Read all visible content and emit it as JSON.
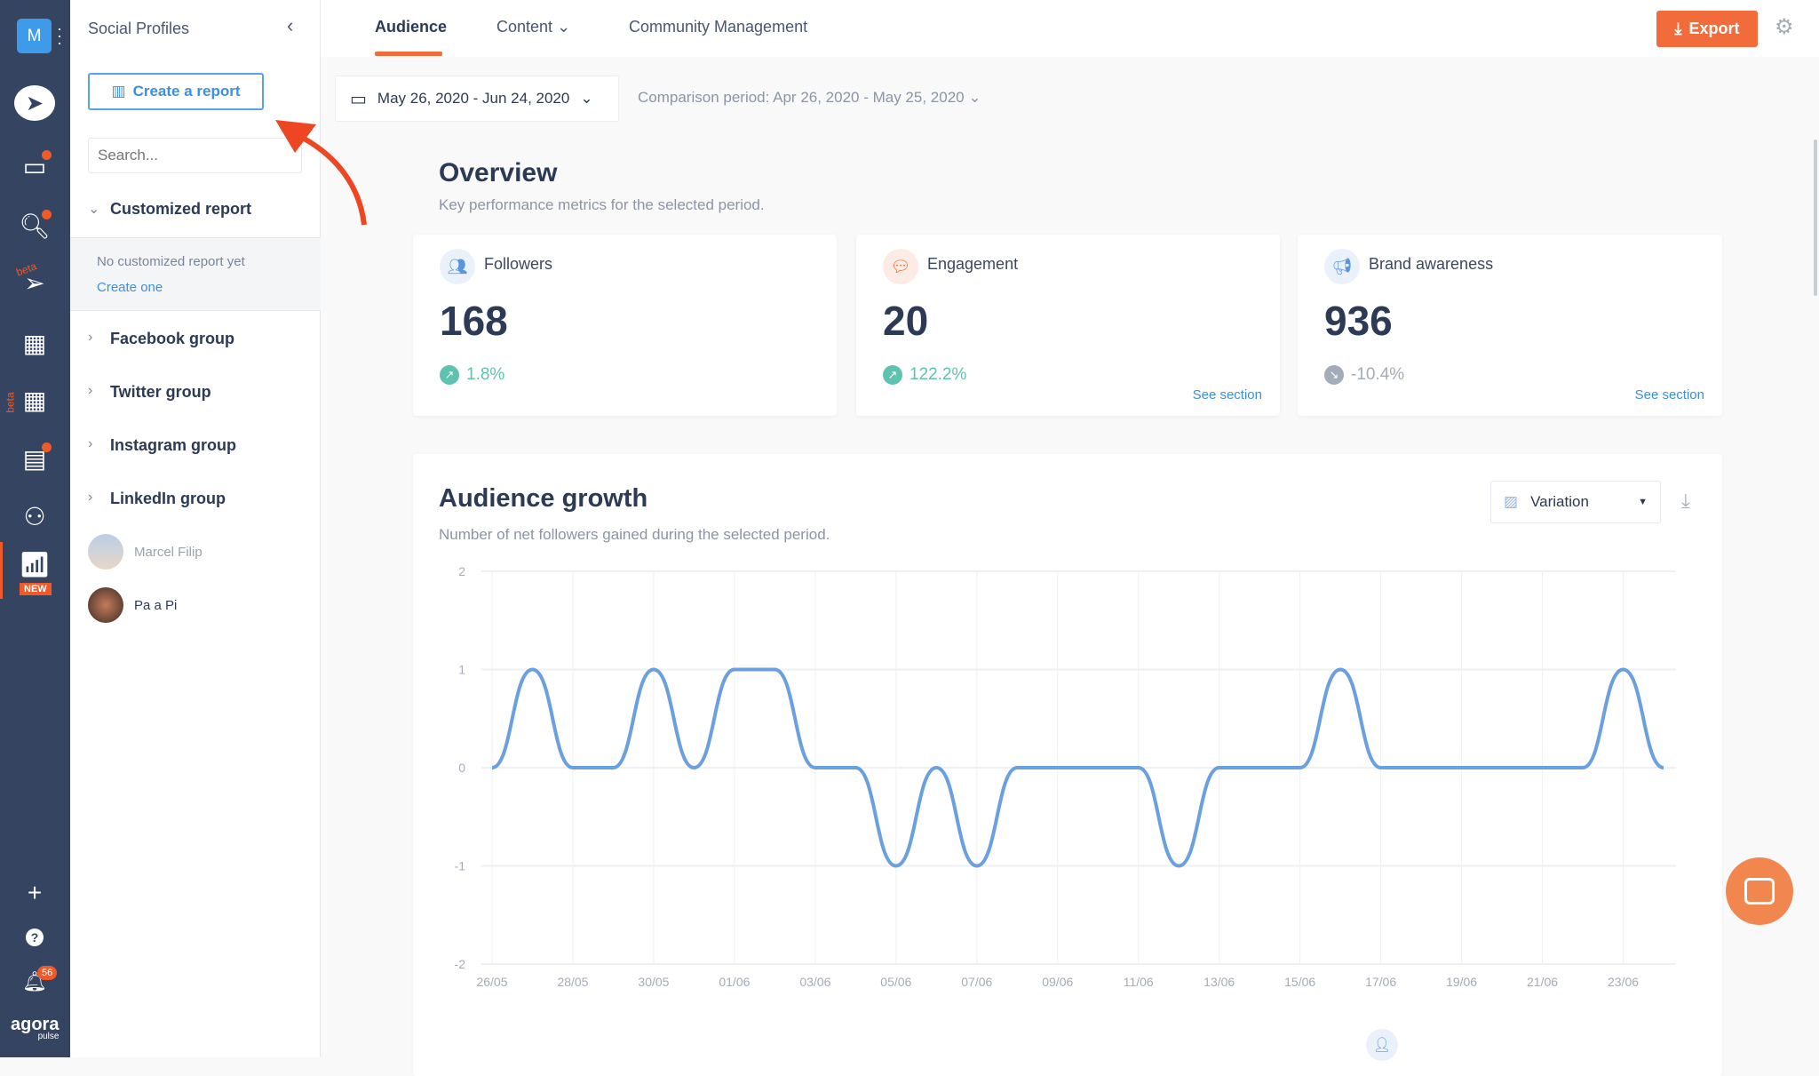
{
  "rail": {
    "avatar_letter": "M",
    "new_badge": "NEW",
    "beta_label": "beta",
    "notification_count": "56",
    "logo": "agora pulse",
    "icons": [
      "publish-icon",
      "inbox-icon",
      "listening-icon",
      "beta-publish-icon",
      "calendar-icon",
      "beta-calendar-icon",
      "reports-list-icon",
      "users-icon",
      "analytics-icon"
    ]
  },
  "sidebar": {
    "title": "Social Profiles",
    "create_report": "Create a report",
    "search_placeholder": "Search...",
    "customized": {
      "label": "Customized report",
      "empty": "No customized report yet",
      "create_link": "Create one"
    },
    "groups": [
      "Facebook group",
      "Twitter group",
      "Instagram group",
      "LinkedIn group"
    ],
    "profiles": [
      {
        "name": "Marcel Filip"
      },
      {
        "name": "Pa a Pi"
      }
    ]
  },
  "tabs": [
    {
      "label": "Audience",
      "active": true
    },
    {
      "label": "Content",
      "dropdown": true
    },
    {
      "label": "Community Management"
    }
  ],
  "export_label": "Export",
  "date_range": "May 26, 2020 - Jun 24, 2020",
  "comparison": "Comparison period: Apr 26, 2020 - May 25, 2020",
  "overview": {
    "title": "Overview",
    "subtitle": "Key performance metrics for the selected period.",
    "cards": [
      {
        "title": "Followers",
        "value": "168",
        "change": "1.8%",
        "trend": "up",
        "color": "#5ec2b0"
      },
      {
        "title": "Engagement",
        "value": "20",
        "change": "122.2%",
        "trend": "up",
        "color": "#5ec2b0",
        "link": "See section"
      },
      {
        "title": "Brand awareness",
        "value": "936",
        "change": "-10.4%",
        "trend": "down",
        "color": "#a4abb9",
        "link": "See section"
      }
    ]
  },
  "growth": {
    "title": "Audience growth",
    "subtitle": "Number of net followers gained during the selected period.",
    "select": "Variation"
  },
  "colors": {
    "accent": "#f26b3a",
    "link": "#3d8fe0",
    "line": "#6a9fe0",
    "rail": "#344461"
  },
  "chart_data": {
    "type": "line",
    "ylim": [
      -2,
      2
    ],
    "yticks": [
      "2",
      "1",
      "0",
      "-1",
      "-2"
    ],
    "grid": true,
    "x": [
      "26/05",
      "27/05",
      "28/05",
      "29/05",
      "30/05",
      "31/05",
      "01/06",
      "02/06",
      "03/06",
      "04/06",
      "05/06",
      "06/06",
      "07/06",
      "08/06",
      "09/06",
      "10/06",
      "11/06",
      "12/06",
      "13/06",
      "14/06",
      "15/06",
      "16/06",
      "17/06",
      "18/06",
      "19/06",
      "20/06",
      "21/06",
      "22/06",
      "23/06",
      "24/06"
    ],
    "xticks": [
      "26/05",
      "28/05",
      "30/05",
      "01/06",
      "03/06",
      "05/06",
      "07/06",
      "09/06",
      "11/06",
      "13/06",
      "15/06",
      "17/06",
      "19/06",
      "21/06",
      "23/06"
    ],
    "values": [
      0,
      1,
      0,
      0,
      1,
      0,
      1,
      1,
      0,
      0,
      -1,
      0,
      -1,
      0,
      0,
      0,
      0,
      -1,
      0,
      0,
      0,
      1,
      0,
      0,
      0,
      0,
      0,
      0,
      1,
      0
    ]
  }
}
